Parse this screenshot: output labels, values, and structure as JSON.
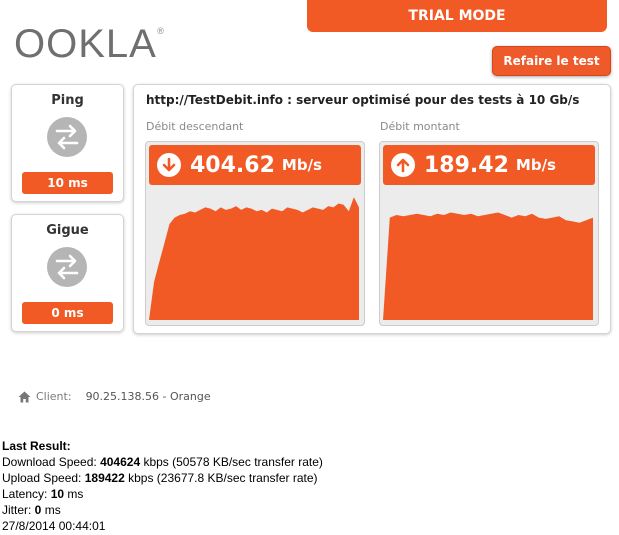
{
  "logo": {
    "text": "OOKLA",
    "mark": "®"
  },
  "header": {
    "trial": "TRIAL MODE",
    "retest": "Refaire le test"
  },
  "ping": {
    "title": "Ping",
    "value": "10 ms"
  },
  "jitter": {
    "title": "Gigue",
    "value": "0 ms"
  },
  "server": "http://TestDebit.info : serveur optimisé pour des tests à 10 Gb/s",
  "download": {
    "label": "Débit descendant",
    "speed": "404.62",
    "unit": "Mb/s",
    "color": "#f15a24",
    "samples": [
      0,
      30,
      45,
      60,
      75,
      80,
      82,
      83,
      85,
      84,
      86,
      88,
      87,
      85,
      88,
      86,
      87,
      89,
      86,
      88,
      87,
      85,
      86,
      84,
      87,
      86,
      85,
      88,
      87,
      86,
      84,
      86,
      88,
      87,
      86,
      89,
      88,
      91,
      90,
      85,
      96,
      88
    ]
  },
  "upload": {
    "label": "Débit montant",
    "speed": "189.42",
    "unit": "Mb/s",
    "color": "#f15a24",
    "samples": [
      0,
      80,
      82,
      81,
      82,
      83,
      82,
      81,
      83,
      82,
      84,
      83,
      82,
      83,
      81,
      82,
      83,
      84,
      82,
      80,
      82,
      81,
      83,
      80,
      79,
      80,
      81,
      78,
      77,
      76,
      78,
      80
    ]
  },
  "client": {
    "label": "Client:",
    "value": "90.25.138.56 - Orange"
  },
  "results": {
    "heading": "Last Result:",
    "download_prefix": "Download Speed: ",
    "download_value": "404624",
    "download_suffix": " kbps (50578 KB/sec transfer rate)",
    "upload_prefix": "Upload Speed: ",
    "upload_value": "189422",
    "upload_suffix": " kbps (23677.8 KB/sec transfer rate)",
    "latency_prefix": "Latency: ",
    "latency_value": "10",
    "latency_suffix": " ms",
    "jitter_prefix": "Jitter: ",
    "jitter_value": "0",
    "jitter_suffix": " ms",
    "timestamp": "27/8/2014 00:44:01"
  },
  "icons": {
    "ping": "arrows-exchange-icon",
    "jitter": "arrows-exchange-icon",
    "download": "arrow-down-icon",
    "upload": "arrow-up-icon",
    "client": "home-icon"
  }
}
